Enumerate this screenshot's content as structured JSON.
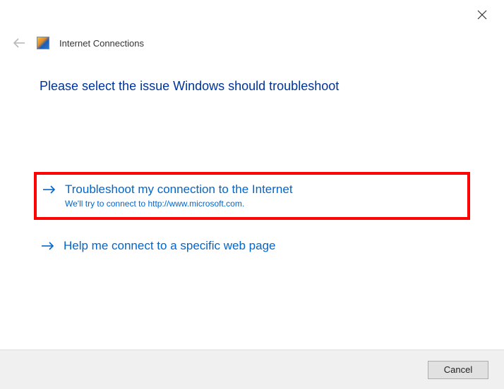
{
  "header": {
    "title": "Internet Connections"
  },
  "main": {
    "heading": "Please select the issue Windows should troubleshoot"
  },
  "options": [
    {
      "title": "Troubleshoot my connection to the Internet",
      "subtitle": "We'll try to connect to http://www.microsoft.com.",
      "highlighted": true
    },
    {
      "title": "Help me connect to a specific web page",
      "subtitle": "",
      "highlighted": false
    }
  ],
  "footer": {
    "cancel_label": "Cancel"
  }
}
